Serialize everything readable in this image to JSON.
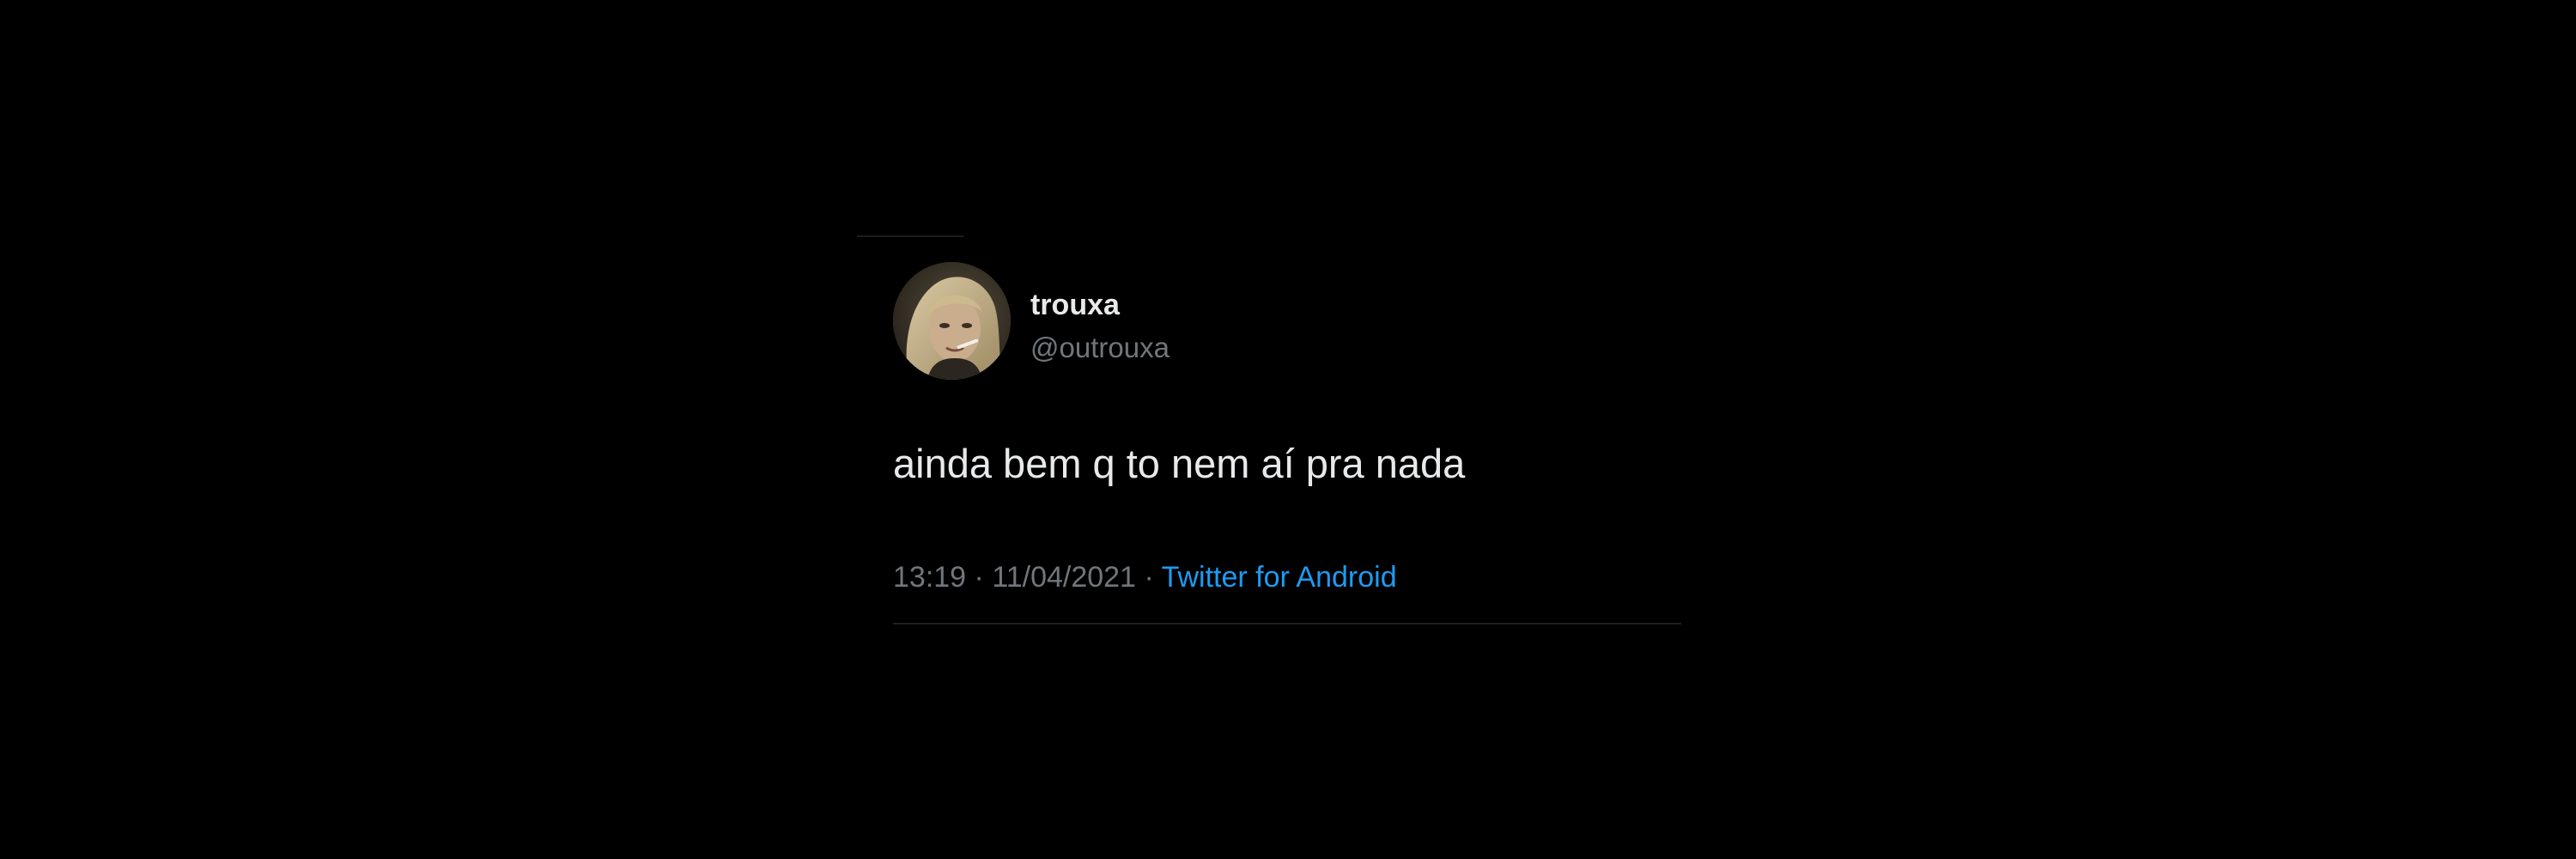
{
  "tweet": {
    "author": {
      "display_name": "trouxa",
      "handle": "@outrouxa",
      "avatar_icon": "profile-photo"
    },
    "text": "ainda bem q to nem aí pra nada",
    "time": "13:19",
    "separator": "·",
    "date": "11/04/2021",
    "source": "Twitter for Android"
  },
  "colors": {
    "background": "#000000",
    "primary_text": "#e7e9ea",
    "secondary_text": "#71767b",
    "link": "#1d9bf0"
  }
}
